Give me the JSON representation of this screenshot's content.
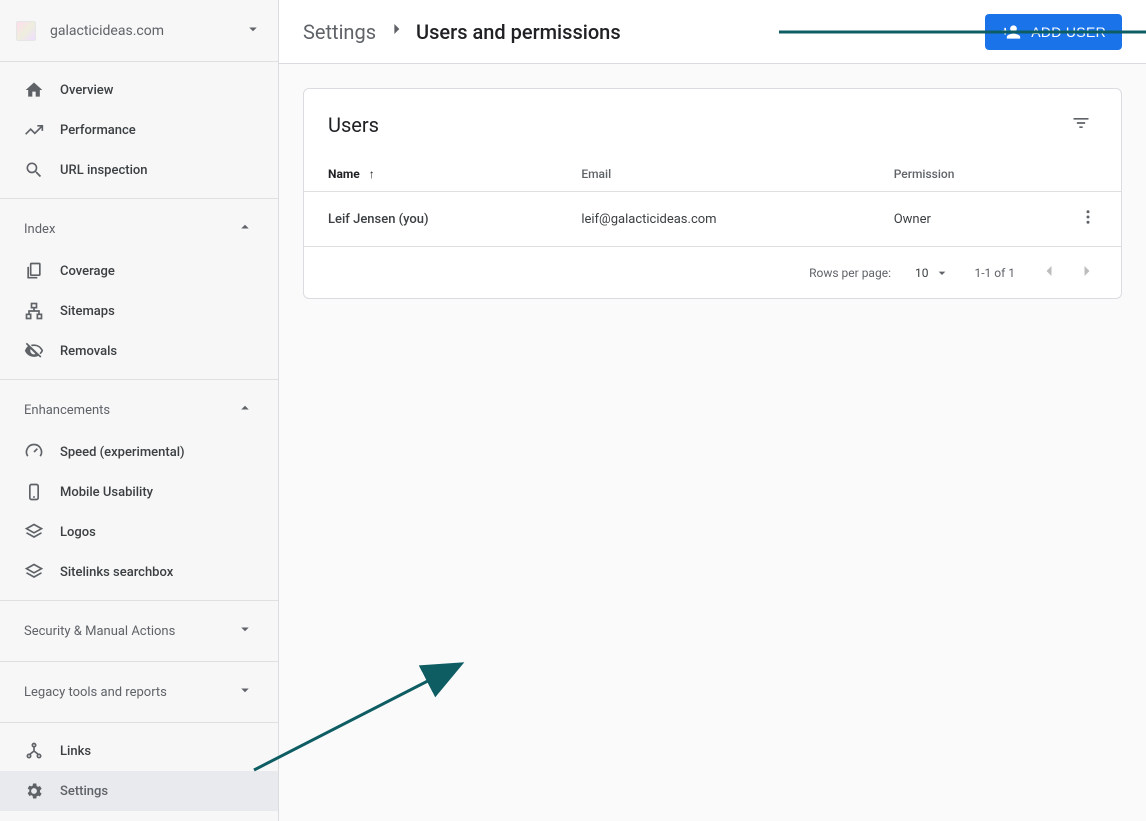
{
  "site": {
    "name": "galacticideas.com"
  },
  "sidebar": {
    "top": [
      {
        "label": "Overview"
      },
      {
        "label": "Performance"
      },
      {
        "label": "URL inspection"
      }
    ],
    "index_heading": "Index",
    "index": [
      {
        "label": "Coverage"
      },
      {
        "label": "Sitemaps"
      },
      {
        "label": "Removals"
      }
    ],
    "enhancements_heading": "Enhancements",
    "enhancements": [
      {
        "label": "Speed (experimental)"
      },
      {
        "label": "Mobile Usability"
      },
      {
        "label": "Logos"
      },
      {
        "label": "Sitelinks searchbox"
      }
    ],
    "security_heading": "Security & Manual Actions",
    "legacy_heading": "Legacy tools and reports",
    "bottom": [
      {
        "label": "Links"
      },
      {
        "label": "Settings"
      }
    ]
  },
  "breadcrumb": {
    "parent": "Settings",
    "current": "Users and permissions"
  },
  "add_user_label": "ADD USER",
  "card": {
    "title": "Users",
    "columns": {
      "name": "Name",
      "email": "Email",
      "permission": "Permission"
    },
    "rows": [
      {
        "name": "Leif Jensen (you)",
        "email": "leif@galacticideas.com",
        "permission": "Owner"
      }
    ],
    "pager": {
      "rows_per_page_label": "Rows per page:",
      "rows_per_page_value": "10",
      "range": "1-1 of 1"
    }
  }
}
